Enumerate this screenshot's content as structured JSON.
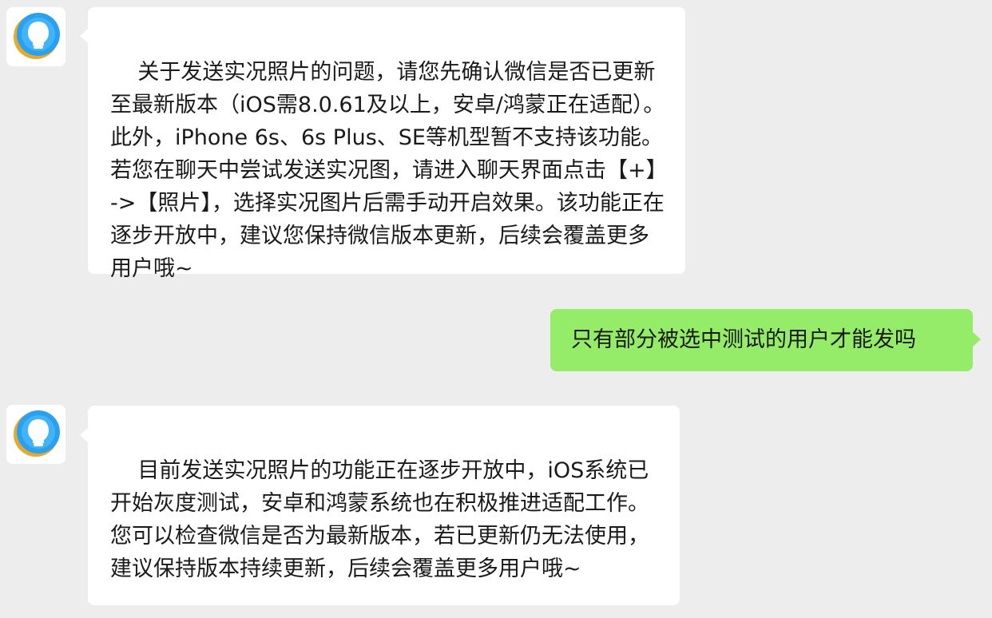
{
  "colors": {
    "background": "#ededed",
    "incoming_bubble": "#ffffff",
    "outgoing_bubble": "#95ec69",
    "text": "#1a1a1a",
    "avatar_accent": "#2aa0f0",
    "avatar_ring": "#e6a92b"
  },
  "messages": [
    {
      "sender": "support",
      "avatar_icon": "customer-service-avatar-icon",
      "text": "关于发送实况照片的问题，请您先确认微信是否已更新至最新版本（iOS需8.0.61及以上，安卓/鸿蒙正在适配）。此外，iPhone 6s、6s Plus、SE等机型暂不支持该功能。若您在聊天中尝试发送实况图，请进入聊天界面点击【+】->【照片】，选择实况图片后需手动开启效果。该功能正在逐步开放中，建议您保持微信版本更新，后续会覆盖更多用户哦~"
    },
    {
      "sender": "user",
      "text": "只有部分被选中测试的用户才能发吗"
    },
    {
      "sender": "support",
      "avatar_icon": "customer-service-avatar-icon",
      "text": "目前发送实况照片的功能正在逐步开放中，iOS系统已开始灰度测试，安卓和鸿蒙系统也在积极推进适配工作。您可以检查微信是否为最新版本，若已更新仍无法使用，建议保持版本持续更新，后续会覆盖更多用户哦~"
    }
  ]
}
